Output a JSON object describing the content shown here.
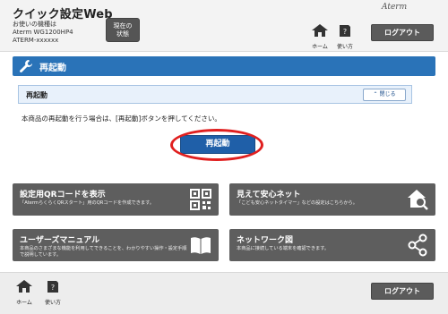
{
  "header": {
    "app_title": "クイック設定Web",
    "model_label": "お使いの機種は",
    "model_name": "Aterm WG1200HP4",
    "serial": "ATERM-xxxxxx",
    "status_button_line1": "現在の",
    "status_button_line2": "状態",
    "brand": "Aterm",
    "home_label": "ホーム",
    "help_label": "使い方",
    "logout_label": "ログアウト"
  },
  "section": {
    "title": "再起動",
    "icon": "wrench-icon"
  },
  "panel": {
    "title": "再起動",
    "collapse_label": "閉じる",
    "description": "本商品の再起動を行う場合は、[再起動]ボタンを押してください。",
    "restart_button": "再起動"
  },
  "tiles": [
    {
      "title": "設定用QRコードを表示",
      "desc": "「AtermらくらくQRスタート」用のQRコードを作成できます。",
      "icon": "qr-code-icon"
    },
    {
      "title": "見えて安心ネット",
      "desc": "「こども安心ネットタイマー」などの設定はこちらから。",
      "icon": "house-search-icon"
    },
    {
      "title": "ユーザーズマニュアル",
      "desc": "本商品のさまざまな機能を利用してできることを、わかりやすい操作・設定手順で説明しています。",
      "icon": "book-icon"
    },
    {
      "title": "ネットワーク図",
      "desc": "本商品に接続している端末を確認できます。",
      "icon": "share-network-icon"
    }
  ],
  "footer": {
    "home_label": "ホーム",
    "help_label": "使い方",
    "logout_label": "ログアウト"
  },
  "colors": {
    "accent_blue": "#2a73b8",
    "button_blue": "#1f5fa8",
    "tile_gray": "#5e5e5e",
    "highlight_red": "#e01f1f"
  }
}
